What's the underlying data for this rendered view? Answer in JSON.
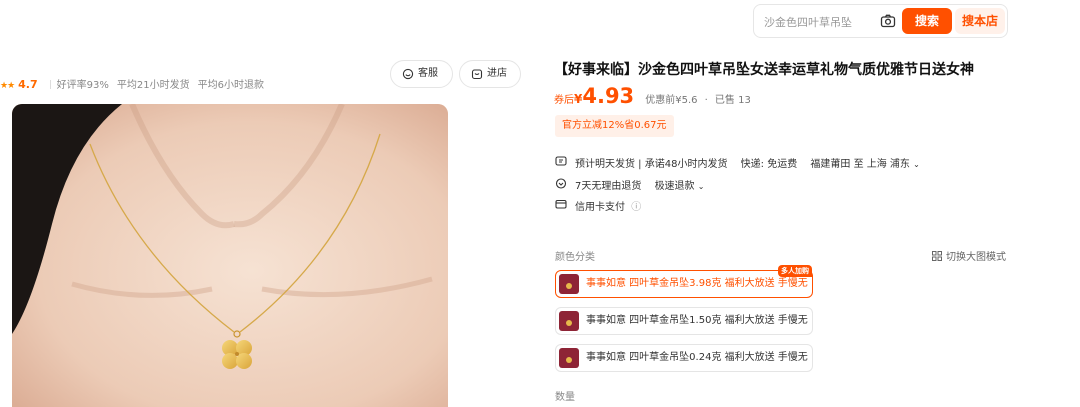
{
  "search": {
    "placeholder": "沙金色四叶草吊坠",
    "search_label": "搜索",
    "shop_search_label": "搜本店"
  },
  "shop": {
    "rating": "4.7",
    "stats": [
      "好评率93%",
      "平均21小时发货",
      "平均6小时退款"
    ],
    "customer_service_label": "客服",
    "enter_shop_label": "进店"
  },
  "product": {
    "title": "【好事来临】沙金色四叶草吊坠女送幸运草礼物气质优雅节日送女神",
    "price_label": "券后",
    "currency": "¥",
    "price": "4.93",
    "original_price": "优惠前¥5.6",
    "sold": "已售 13",
    "promo": "官方立减12%省0.67元"
  },
  "delivery": {
    "ship_time": "预计明天发货 | 承诺48小时内发货",
    "shipping_fee": "快递: 免运费",
    "route": "福建莆田 至 上海 浦东",
    "returns": "7天无理由退货",
    "refund": "极速退款",
    "payment": "信用卡支付"
  },
  "options": {
    "section_label": "颜色分类",
    "big_image_mode": "切换大图模式",
    "items": [
      {
        "label": "事事如意 四叶草金吊坠3.98克 福利大放送 手慢无",
        "selected": true,
        "badge": "多人加购"
      },
      {
        "label": "事事如意 四叶草金吊坠1.50克 福利大放送 手慢无",
        "selected": false
      },
      {
        "label": "事事如意 四叶草金吊坠0.24克 福利大放送 手慢无",
        "selected": false
      }
    ]
  },
  "quantity_label": "数量",
  "colors": {
    "accent": "#ff5000",
    "accent_light": "#fff0e8",
    "rating": "#ff8a00"
  }
}
